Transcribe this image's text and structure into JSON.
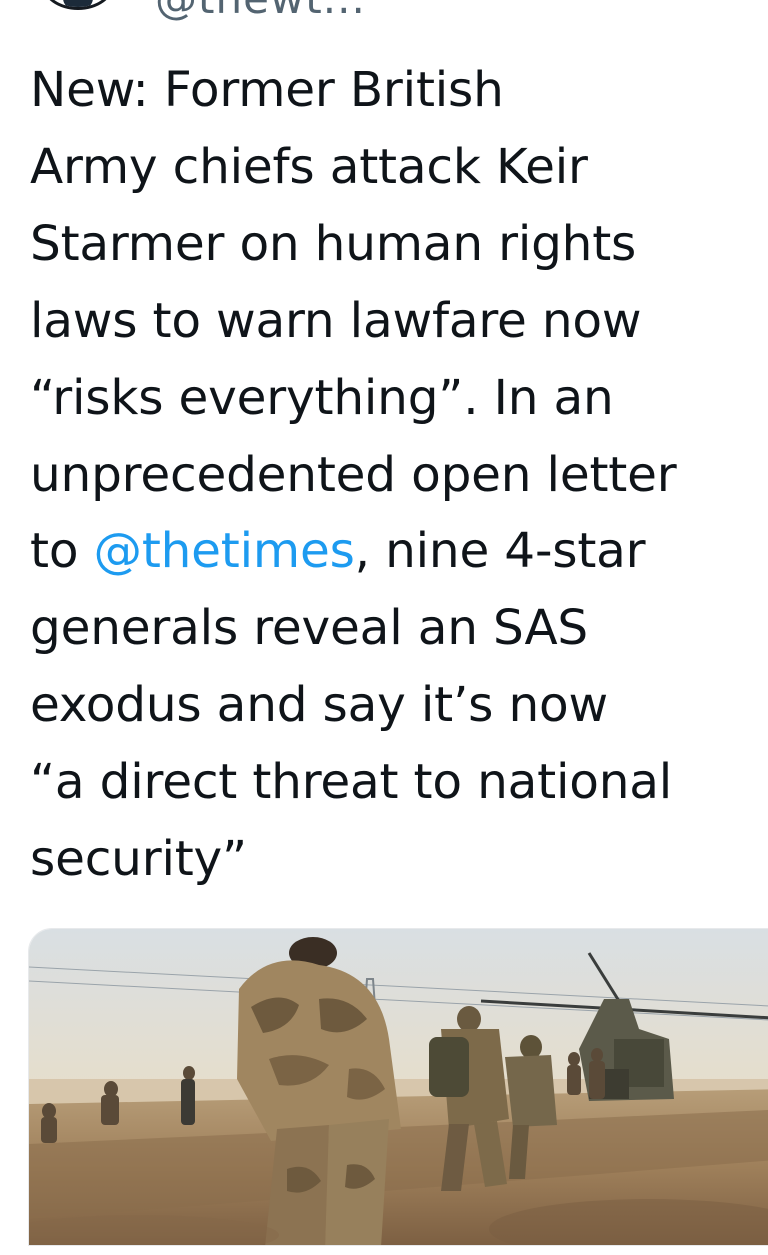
{
  "tweet": {
    "author_handle": "@thewt...",
    "avatar": "avatar-image",
    "text_lines": [
      "New: Former British",
      "Army chiefs attack Keir",
      "Starmer on human rights",
      "laws to warn lawfare now",
      "“risks everything”. In an",
      "unprecedented open letter"
    ],
    "line7_before": "to ",
    "mention": "@thetimes",
    "line7_after": ", nine 4-star",
    "text_lines_end": [
      "generals reveal an SAS",
      "exodus and say it’s now",
      "“a direct threat to national",
      "security”"
    ],
    "colors": {
      "text": "#0f1419",
      "mention": "#1d9bf0",
      "handle": "#536471"
    }
  },
  "media": {
    "kind": "photo",
    "subject": "soldiers-running-to-helicopter"
  }
}
